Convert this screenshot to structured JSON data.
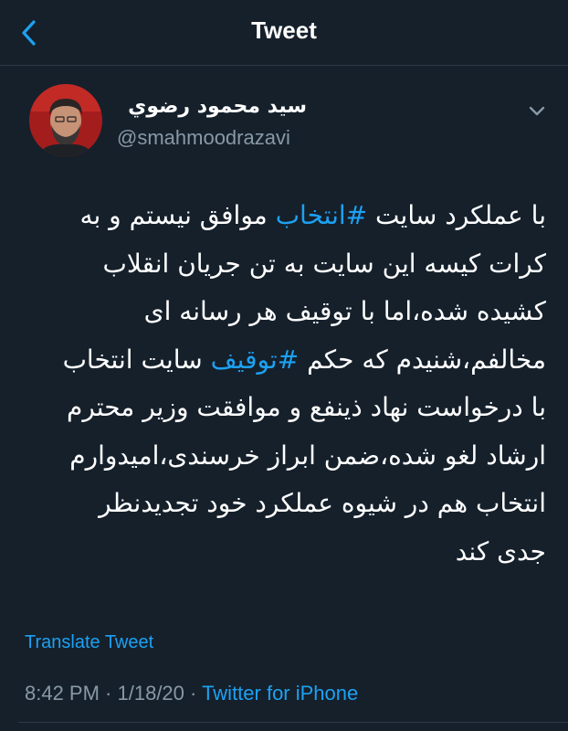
{
  "header": {
    "title": "Tweet",
    "back_icon": "chevron-left-icon"
  },
  "author": {
    "name": "سید محمود رضوي",
    "handle": "@smahmoodrazavi",
    "avatar_icon": "avatar-photo"
  },
  "menu": {
    "icon": "chevron-down-icon"
  },
  "tweet": {
    "lines": [
      {
        "before": "با عملکرد سایت ",
        "hashtag": "#انتخاب",
        "after": " موافق نیستم و به"
      },
      {
        "text": "کرات کیسه این سایت به تن جریان انقلاب"
      },
      {
        "text": "کشیده شده،اما با توقیف هر رسانه ای"
      },
      {
        "before": "مخالفم،شنیدم که حکم ",
        "hashtag": "#توقیف",
        "after": " سایت انتخاب"
      },
      {
        "text": "با درخواست نهاد ذینفع و موافقت وزیر محترم"
      },
      {
        "text": "ارشاد لغو شده،ضمن ابراز خرسندی،امیدوارم"
      },
      {
        "text": "انتخاب هم در شیوه عملکرد خود تجدیدنظر"
      },
      {
        "text": "جدی کند"
      }
    ]
  },
  "translate_label": "Translate Tweet",
  "meta": {
    "time": "8:42 PM",
    "separator": " · ",
    "date": "1/18/20",
    "source": "Twitter for iPhone"
  },
  "colors": {
    "background": "#15202b",
    "accent": "#1da1f2",
    "secondary_text": "#8899a6",
    "divider": "#2c3a47"
  }
}
